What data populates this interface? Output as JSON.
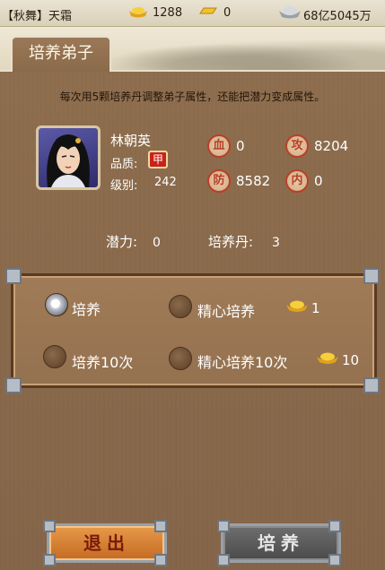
{
  "topbar": {
    "name": "【秋舞】天霜",
    "gold": "1288",
    "yuanbao": "0",
    "silver": "68亿5045万"
  },
  "tab": {
    "title": "培养弟子"
  },
  "description": "每次用5颗培养丹调整弟子属性，还能把潜力变成属性。",
  "disciple": {
    "name": "林朝英",
    "quality_label": "品质:",
    "quality_badge": "甲",
    "level_label": "级别:",
    "level": "242"
  },
  "stats": [
    {
      "icon": "血",
      "icon_name": "blood-icon",
      "value": "0"
    },
    {
      "icon": "攻",
      "icon_name": "attack-icon",
      "value": "8204"
    },
    {
      "icon": "防",
      "icon_name": "defense-icon",
      "value": "8582"
    },
    {
      "icon": "内",
      "icon_name": "inner-force-icon",
      "value": "0"
    }
  ],
  "potential": {
    "label": "潜力:",
    "value": "0"
  },
  "pill": {
    "label": "培养丹:",
    "value": "3"
  },
  "options": [
    {
      "label": "培养",
      "selected": true
    },
    {
      "label": "精心培养",
      "selected": false,
      "cost": "1"
    },
    {
      "label": "培养10次",
      "selected": false
    },
    {
      "label": "精心培养10次",
      "selected": false,
      "cost": "10"
    }
  ],
  "buttons": {
    "exit": "退出",
    "train": "培养"
  },
  "colors": {
    "gold": "#f2c12e",
    "panel": "#8e6e4e",
    "stat_red": "#b8402a"
  }
}
